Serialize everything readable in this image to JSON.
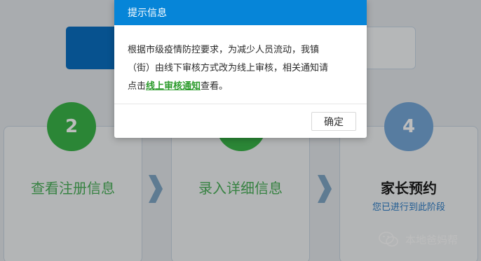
{
  "steps": [
    {
      "number": "2",
      "title": "查看注册信息",
      "subtitle": ""
    },
    {
      "number": "3",
      "title": "录入详细信息",
      "subtitle": ""
    },
    {
      "number": "4",
      "title": "家长预约",
      "subtitle": "您已进行到此阶段"
    }
  ],
  "watermark": {
    "text": "本地爸妈帮"
  },
  "modal": {
    "title": "提示信息",
    "line1": "根据市级疫情防控要求，为减少人员流动，我镇",
    "line2": "（街）由线下审核方式改为线上审核，相关通知请",
    "line3_prefix": "点击",
    "link_text": "线上审核通知",
    "line3_suffix": "查看。",
    "ok_label": "确定"
  },
  "colors": {
    "header": "#0685d8",
    "green": "#3bb54a",
    "blue": "#76a8d8",
    "link": "#2a9a2a"
  }
}
